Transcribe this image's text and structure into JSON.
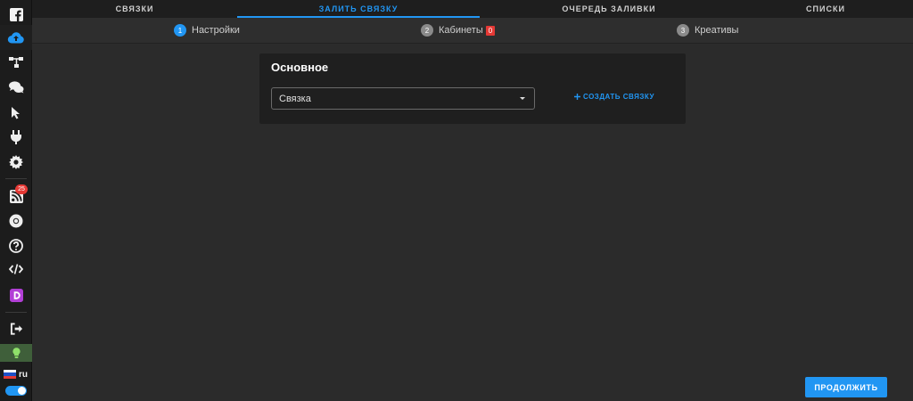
{
  "tabs": [
    {
      "label": "СВЯЗКИ",
      "active": false
    },
    {
      "label": "ЗАЛИТЬ СВЯЗКУ",
      "active": true
    },
    {
      "label": "ОЧЕРЕДЬ ЗАЛИВКИ",
      "active": false
    },
    {
      "label": "СПИСКИ",
      "active": false
    }
  ],
  "steps": [
    {
      "num": "1",
      "label": "Настройки",
      "active": true
    },
    {
      "num": "2",
      "label": "Кабинеты",
      "count": "0",
      "active": false
    },
    {
      "num": "3",
      "label": "Креативы",
      "active": false
    }
  ],
  "card": {
    "title": "Основное",
    "select_value": "Связка",
    "create_label": "СОЗДАТЬ СВЯЗКУ"
  },
  "sidebar": {
    "items": [
      {
        "icon": "facebook-icon"
      },
      {
        "icon": "cloud-upload-icon",
        "active": true
      },
      {
        "icon": "sitemap-icon"
      },
      {
        "icon": "chat-icon"
      },
      {
        "icon": "cursor-icon"
      },
      {
        "icon": "plug-icon"
      },
      {
        "icon": "gear-icon"
      },
      {
        "icon": "rss-icon",
        "badge": "25"
      },
      {
        "icon": "chrome-icon"
      },
      {
        "icon": "help-icon"
      },
      {
        "icon": "code-icon"
      },
      {
        "icon": "d-app-icon"
      },
      {
        "icon": "logout-icon"
      },
      {
        "icon": "lightbulb-icon"
      }
    ],
    "language": "ru"
  },
  "actions": {
    "continue_label": "ПРОДОЛЖИТЬ"
  },
  "colors": {
    "accent": "#2196f3",
    "badge": "#e53935",
    "background": "#2b2b2b",
    "sidebar": "#1c1c1c"
  }
}
